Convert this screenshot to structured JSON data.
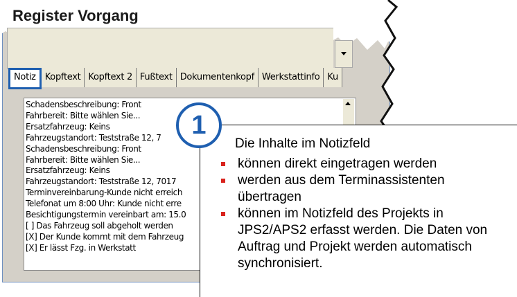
{
  "window": {
    "title": "Register Vorgang"
  },
  "tabs": [
    {
      "label": "Notiz"
    },
    {
      "label": "Kopftext"
    },
    {
      "label": "Kopftext 2"
    },
    {
      "label": "Fußtext"
    },
    {
      "label": "Dokumentenkopf"
    },
    {
      "label": "Werkstattinfo"
    },
    {
      "label": "Ku"
    }
  ],
  "notes": {
    "lines": [
      "Schadensbeschreibung: Front",
      "Fahrbereit: Bitte wählen Sie...",
      "Ersatzfahrzeug: Keins",
      "Fahrzeugstandort: Teststraße 12, 7",
      "Schadensbeschreibung: Front",
      "Fahrbereit: Bitte wählen Sie...",
      "Ersatzfahrzeug: Keins",
      "Fahrzeugstandort: Teststraße 12, 7017",
      "Terminvereinbarung-Kunde nicht erreich",
      "Telefonat um 8:00 Uhr: Kunde nicht erre",
      "Besichtigungstermin vereinbart am: 15.0",
      "[ ] Das Fahrzeug soll abgeholt werden",
      "[X] Der Kunde kommt mit dem Fahrzeug",
      "[X] Er lässt Fzg. in Werkstatt"
    ]
  },
  "callout": {
    "badge": "1",
    "intro": "Die Inhalte im Notizfeld",
    "bullets": [
      "können direkt eingetragen werden",
      "werden aus dem Terminassistenten übertragen",
      "können im Notizfeld des Projekts in JPS2/APS2 erfasst werden. Die Daten von Auftrag und Projekt werden automatisch synchronisiert."
    ]
  },
  "colors": {
    "accent": "#1f5fb0",
    "bullet": "#d9231d"
  }
}
